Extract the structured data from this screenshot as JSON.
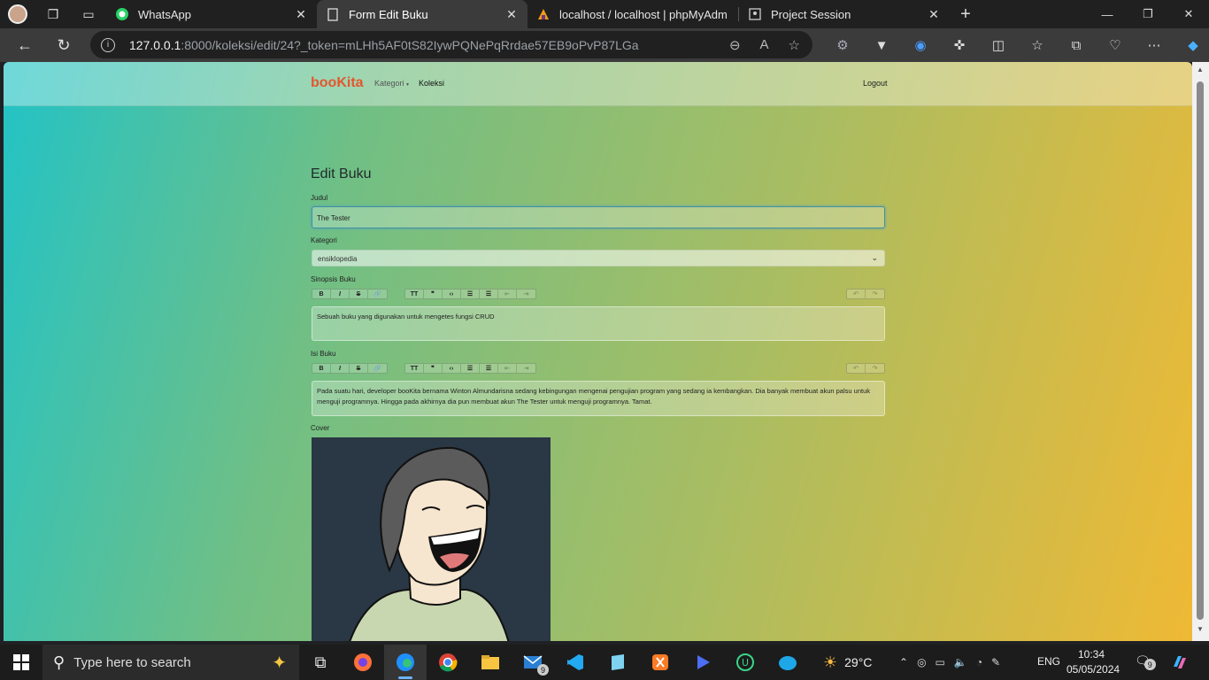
{
  "browser": {
    "tabs": [
      {
        "title": "WhatsApp",
        "icon": "whatsapp-icon",
        "active": false
      },
      {
        "title": "Form Edit Buku",
        "icon": "page-icon",
        "active": true
      },
      {
        "title": "localhost / localhost | phpMyAdm",
        "icon": "phpmyadmin-icon",
        "active": false
      },
      {
        "title": "Project Session",
        "icon": "page-icon",
        "active": false
      }
    ],
    "url_host": "127.0.0.1",
    "url_rest": ":8000/koleksi/edit/24?_token=mLHh5AF0tS82IywPQNePqRrdae57EB9oPvP87LGa"
  },
  "nav": {
    "brand": "booKita",
    "kategori": "Kategori",
    "koleksi": "Koleksi",
    "logout": "Logout"
  },
  "form": {
    "heading": "Edit Buku",
    "judul_label": "Judul",
    "judul_value": "The Tester",
    "kategori_label": "Kategori",
    "kategori_value": "ensiklopedia",
    "sinopsis_label": "Sinopsis Buku",
    "sinopsis_value": "Sebuah buku yang digunakan untuk mengetes fungsi CRUD",
    "isi_label": "Isi Buku",
    "isi_value": "Pada suatu hari, developer booKita bernama Winton Almundarisna sedang kebingungan mengenai pengujian program yang sedang ia kembangkan. Dia banyak membuat akun palsu untuk menguji programnya. Hingga pada akhirnya dia pun membuat akun The Tester untuk menguji programnya. Tamat.",
    "cover_label": "Cover"
  },
  "taskbar": {
    "search_placeholder": "Type here to search",
    "weather": "29°C",
    "lang": "ENG",
    "time": "10:34",
    "date": "05/05/2024",
    "mail_badge": "9",
    "notif_badge": "9"
  }
}
